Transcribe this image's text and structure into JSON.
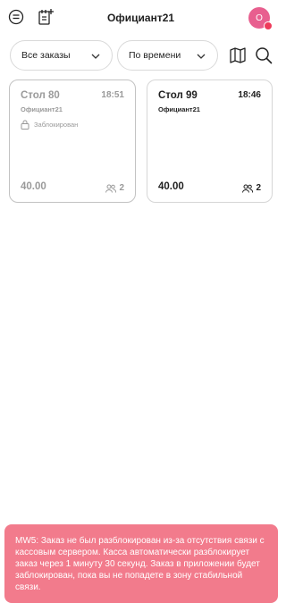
{
  "header": {
    "title": "Официант21",
    "avatar_initial": "О"
  },
  "filters": {
    "orders_select": "Все заказы",
    "sort_select": "По времени"
  },
  "orders": [
    {
      "table": "Стол 80",
      "time": "18:51",
      "waiter": "Официант21",
      "status": "Заблокирован",
      "sum": "40.00",
      "guests": "2"
    },
    {
      "table": "Стол 99",
      "time": "18:46",
      "waiter": "Официант21",
      "sum": "40.00",
      "guests": "2"
    }
  ],
  "toast": {
    "message": "MW5: Заказ не был разблокирован из-за отсутствия связи с кассовым сервером. Касса автоматически разблокирует заказ через 1 минуту 30 секунд. Заказ в приложении будет заблокирован, пока вы не попадете в зону стабильной связи."
  },
  "colors": {
    "accent": "#e85f8f",
    "toast_bg": "#f27b8c",
    "locked_text": "#9a9a9a"
  },
  "icons": [
    "menu-icon",
    "new-order-icon",
    "chevron-down-icon",
    "map-icon",
    "search-icon",
    "lock-icon",
    "guests-icon"
  ]
}
